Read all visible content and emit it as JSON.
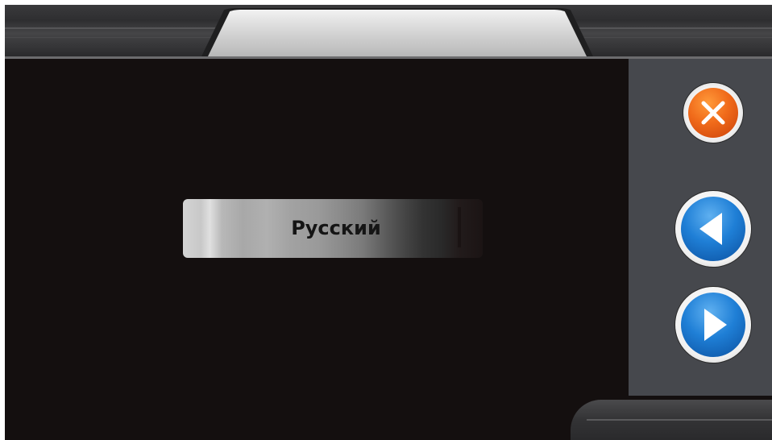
{
  "language_selector": {
    "current_language": "Русский"
  },
  "icons": {
    "close": "close-icon",
    "previous": "arrow-left-icon",
    "next": "arrow-right-icon"
  },
  "colors": {
    "content_background": "#140f0f",
    "side_panel": "#46484d",
    "close_button": "#f06a1a",
    "arrow_buttons": "#1f7fd6"
  }
}
